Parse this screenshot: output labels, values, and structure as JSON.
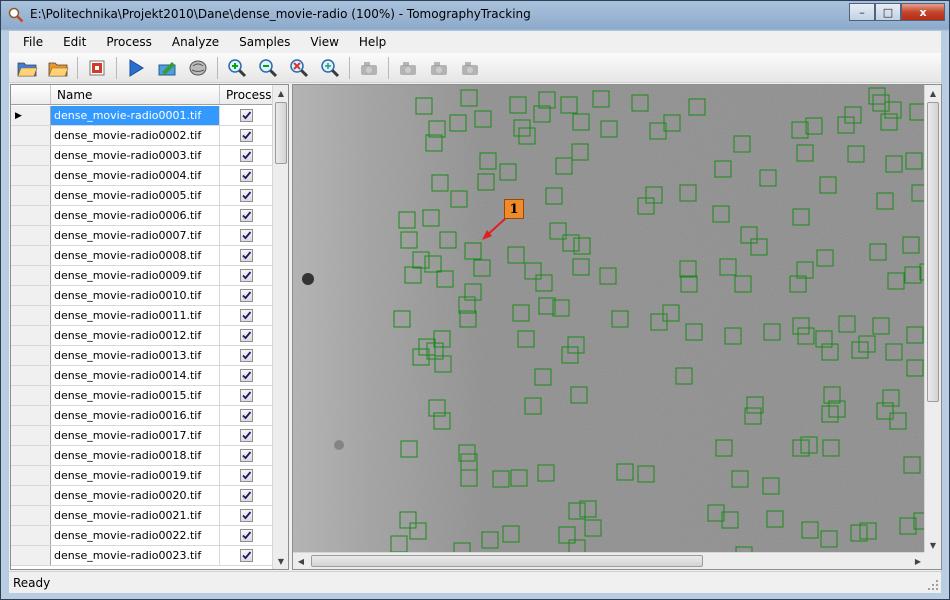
{
  "window": {
    "title": "E:\\Politechnika\\Projekt2010\\Dane\\dense_movie-radio (100%) - TomographyTracking",
    "minimize": "–",
    "maximize": "□",
    "close": "x"
  },
  "menu": [
    "File",
    "Edit",
    "Process",
    "Analyze",
    "Samples",
    "View",
    "Help"
  ],
  "toolbar": [
    {
      "name": "open-folder-icon",
      "color": "#3d7fd8"
    },
    {
      "name": "open-project-icon",
      "color": "#e7962a"
    },
    {
      "name": "stop-icon",
      "color": "#d23a2a"
    },
    {
      "name": "play-icon",
      "color": "#2a6fd0"
    },
    {
      "name": "edit-icon",
      "color": "#3a9a3a"
    },
    {
      "name": "brain-icon",
      "color": "#8a8a8a"
    },
    {
      "name": "zoom-in-icon",
      "color": "#2a8fd0"
    },
    {
      "name": "zoom-out-icon",
      "color": "#2a8fd0"
    },
    {
      "name": "zoom-reset-icon",
      "color": "#d03a2a"
    },
    {
      "name": "zoom-fit-icon",
      "color": "#2a9a6a"
    },
    {
      "name": "camera-icon",
      "color": "#9a9a9a"
    },
    {
      "name": "camera-prev-icon",
      "color": "#9a9a9a"
    },
    {
      "name": "camera-next-icon",
      "color": "#9a9a9a"
    },
    {
      "name": "camera-settings-icon",
      "color": "#9a9a9a"
    }
  ],
  "grid": {
    "columns": [
      "Name",
      "Process"
    ],
    "rows": [
      {
        "name": "dense_movie-radio0001.tif",
        "process": true,
        "selected": true
      },
      {
        "name": "dense_movie-radio0002.tif",
        "process": true
      },
      {
        "name": "dense_movie-radio0003.tif",
        "process": true
      },
      {
        "name": "dense_movie-radio0004.tif",
        "process": true
      },
      {
        "name": "dense_movie-radio0005.tif",
        "process": true
      },
      {
        "name": "dense_movie-radio0006.tif",
        "process": true
      },
      {
        "name": "dense_movie-radio0007.tif",
        "process": true
      },
      {
        "name": "dense_movie-radio0008.tif",
        "process": true
      },
      {
        "name": "dense_movie-radio0009.tif",
        "process": true
      },
      {
        "name": "dense_movie-radio0010.tif",
        "process": true
      },
      {
        "name": "dense_movie-radio0011.tif",
        "process": true
      },
      {
        "name": "dense_movie-radio0012.tif",
        "process": true
      },
      {
        "name": "dense_movie-radio0013.tif",
        "process": true
      },
      {
        "name": "dense_movie-radio0014.tif",
        "process": true
      },
      {
        "name": "dense_movie-radio0015.tif",
        "process": true
      },
      {
        "name": "dense_movie-radio0016.tif",
        "process": true
      },
      {
        "name": "dense_movie-radio0017.tif",
        "process": true
      },
      {
        "name": "dense_movie-radio0018.tif",
        "process": true
      },
      {
        "name": "dense_movie-radio0019.tif",
        "process": true
      },
      {
        "name": "dense_movie-radio0020.tif",
        "process": true
      },
      {
        "name": "dense_movie-radio0021.tif",
        "process": true
      },
      {
        "name": "dense_movie-radio0022.tif",
        "process": true
      },
      {
        "name": "dense_movie-radio0023.tif",
        "process": true
      }
    ]
  },
  "viewer": {
    "callout_label": "1",
    "marker_color": "#1a8a1a",
    "callout_color": "#f08a2a",
    "arrow_color": "#e02020"
  },
  "status": {
    "text": "Ready"
  }
}
